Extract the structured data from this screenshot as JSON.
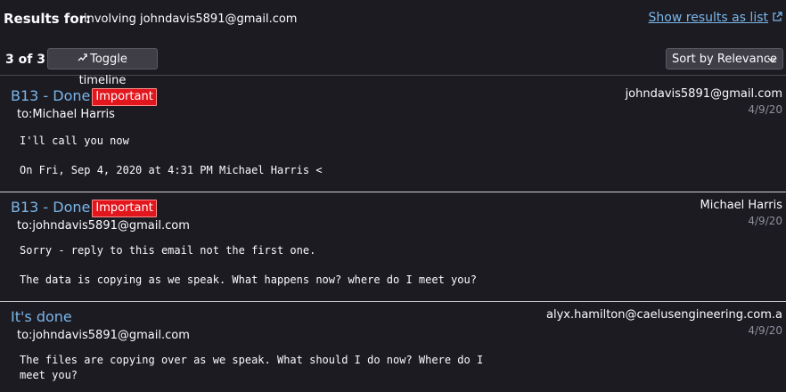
{
  "header": {
    "results_label": "Results for:",
    "query": "involving johndavis5891@gmail.com",
    "show_list_label": "Show results as list"
  },
  "toolbar": {
    "count": "3 of 3",
    "toggle_label": "Toggle timeline",
    "sort_label": "Sort by Relevance"
  },
  "messages": [
    {
      "subject": "B13 - Done",
      "badge": "Important",
      "recipient": "to:Michael Harris",
      "sender": "johndavis5891@gmail.com",
      "date": "4/9/20",
      "body": [
        "I'll call you now",
        "On Fri, Sep 4, 2020 at 4:31 PM Michael Harris <"
      ]
    },
    {
      "subject": "B13 - Done",
      "badge": "Important",
      "recipient": "to:johndavis5891@gmail.com",
      "sender": "Michael Harris",
      "date": "4/9/20",
      "body": [
        "Sorry - reply to this email not the first one.",
        "The data is copying as we speak. What happens now? where do I meet you?"
      ]
    },
    {
      "subject": "It's done",
      "recipient": "to:johndavis5891@gmail.com",
      "sender": "alyx.hamilton@caelusengineering.com.a",
      "date": "4/9/20",
      "body": [
        "The files are copying over as we speak. What should I do now? Where do I",
        "meet you?"
      ]
    }
  ],
  "icons": {
    "show_list": "open-in-new-icon",
    "toggle": "trend-arrow-icon",
    "sort": "chevron-down-icon"
  },
  "colors": {
    "background": "#1c1b22",
    "link": "#7ab6ea",
    "badge": "#e2161d",
    "date": "#8f8f9d"
  }
}
